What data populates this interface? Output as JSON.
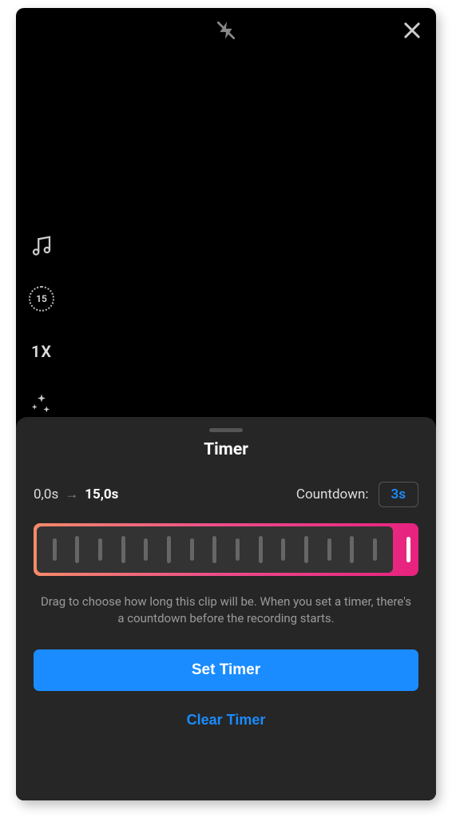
{
  "sheet": {
    "title": "Timer",
    "range_start": "0,0s",
    "range_end": "15,0s",
    "countdown_label": "Countdown:",
    "countdown_value": "3s",
    "help_text": "Drag to choose how long this clip will be. When you set a timer, there's a countdown before the recording starts.",
    "set_button": "Set Timer",
    "clear_button": "Clear Timer"
  },
  "tools": {
    "speed": "1X",
    "timer_badge": "15"
  },
  "icons": {
    "flash": "flash-off-icon",
    "close": "close-icon",
    "music": "music-icon",
    "timer": "timer-15-icon",
    "speed": "speed-icon",
    "effects": "sparkles-icon"
  },
  "colors": {
    "accent": "#1a8cff",
    "slider_grad_start": "#f58a6a",
    "slider_grad_end": "#e7227f"
  }
}
